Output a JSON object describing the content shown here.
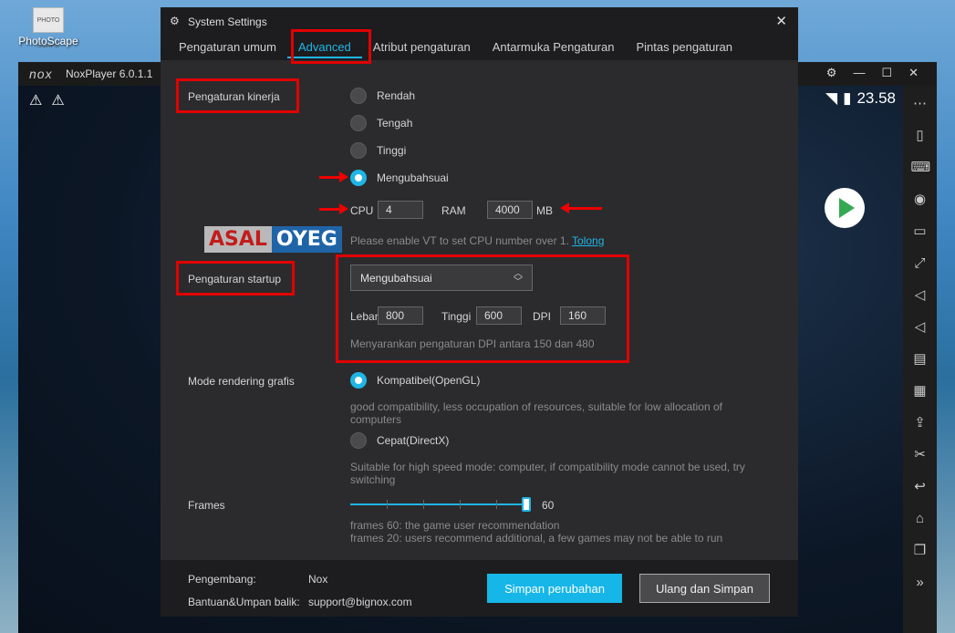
{
  "desktop": {
    "icon_label": "PhotoScape",
    "icon_caption": "PHOTO SCAPE"
  },
  "nox": {
    "logo": "nox",
    "title": "NoxPlayer 6.0.1.1",
    "time": "23.58"
  },
  "dialog": {
    "title": "System Settings",
    "tabs": [
      "Pengaturan umum",
      "Advanced",
      "Atribut pengaturan",
      "Antarmuka Pengaturan",
      "Pintas pengaturan"
    ],
    "performance": {
      "label": "Pengaturan kinerja",
      "options": [
        "Rendah",
        "Tengah",
        "Tinggi",
        "Mengubahsuai"
      ],
      "selected": "Mengubahsuai",
      "cpu_label": "CPU",
      "cpu_value": "4",
      "ram_label": "RAM",
      "ram_value": "4000",
      "ram_unit": "MB",
      "hint": "Please enable VT to set CPU number over 1.",
      "hint_link": "Tolong"
    },
    "startup": {
      "label": "Pengaturan startup",
      "selected": "Mengubahsuai",
      "width_label": "Lebar",
      "width_value": "800",
      "height_label": "Tinggi",
      "height_value": "600",
      "dpi_label": "DPI",
      "dpi_value": "160",
      "hint": "Menyarankan pengaturan DPI antara 150 dan 480"
    },
    "rendering": {
      "label": "Mode rendering grafis",
      "opt1": "Kompatibel(OpenGL)",
      "opt1_desc": "good compatibility, less occupation of resources, suitable for low allocation of computers",
      "opt2": "Cepat(DirectX)",
      "opt2_desc": "Suitable for high speed mode: computer, if compatibility mode cannot be used, try switching"
    },
    "frames": {
      "label": "Frames",
      "value": "60",
      "level": 1.0,
      "hint1": "frames 60: the game user recommendation",
      "hint2": "frames 20: users recommend additional, a few games may not be able to run"
    },
    "footer": {
      "dev_label": "Pengembang:",
      "dev_value": "Nox",
      "support_label": "Bantuan&Umpan balik:",
      "support_value": "support@bignox.com",
      "save_button": "Simpan perubahan",
      "restart_button": "Ulang dan Simpan"
    }
  },
  "watermark": {
    "part1": "ASAL",
    "part2": "OYEG"
  },
  "colors": {
    "accent": "#1fb5e6",
    "highlight": "#e20000"
  }
}
